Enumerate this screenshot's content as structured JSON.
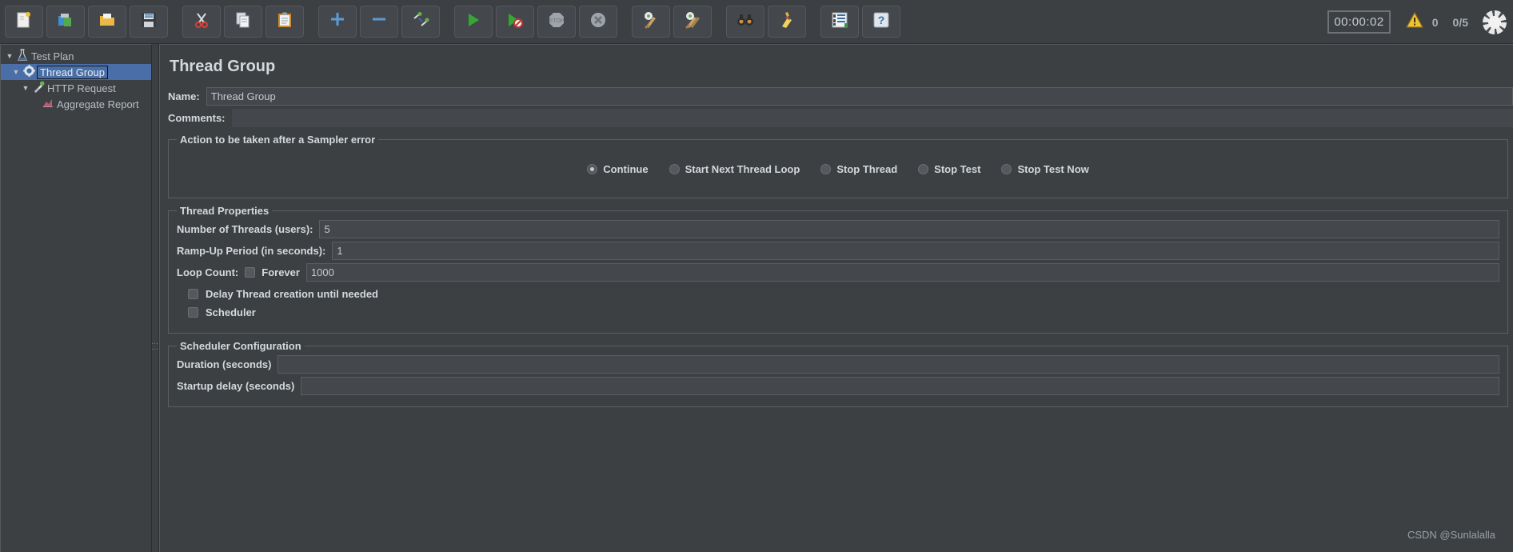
{
  "toolbar": {
    "buttons": [
      {
        "name": "new-test-plan-button",
        "icon": "new-document-icon",
        "glyph": "🗎",
        "label": "New"
      },
      {
        "name": "templates-button",
        "icon": "templates-icon",
        "glyph": "📦",
        "label": "Templates"
      },
      {
        "name": "open-button",
        "icon": "open-folder-icon",
        "glyph": "📂",
        "label": "Open"
      },
      {
        "name": "save-button",
        "icon": "floppy-disk-icon",
        "glyph": "💾",
        "label": "Save Test Plan"
      },
      {
        "name": "cut-button",
        "icon": "scissors-icon",
        "glyph": "✂",
        "label": "Cut"
      },
      {
        "name": "copy-button",
        "icon": "copy-icon",
        "glyph": "🗐",
        "label": "Copy"
      },
      {
        "name": "paste-button",
        "icon": "clipboard-icon",
        "glyph": "📋",
        "label": "Paste"
      },
      {
        "name": "expand-all-button",
        "icon": "plus-icon",
        "glyph": "+",
        "label": "Expand All"
      },
      {
        "name": "collapse-all-button",
        "icon": "minus-icon",
        "glyph": "−",
        "label": "Collapse All"
      },
      {
        "name": "toggle-button",
        "icon": "toggle-icon",
        "glyph": "🖉",
        "label": "Toggle"
      },
      {
        "name": "start-button",
        "icon": "play-icon",
        "glyph": "▶",
        "label": "Start"
      },
      {
        "name": "start-no-pauses-button",
        "icon": "play-no-pause-icon",
        "glyph": "▶",
        "label": "Start no pauses"
      },
      {
        "name": "stop-button",
        "icon": "stop-sign-icon",
        "glyph": "⬣",
        "label": "Stop"
      },
      {
        "name": "shutdown-button",
        "icon": "shutdown-icon",
        "glyph": "✖",
        "label": "Shutdown"
      },
      {
        "name": "clear-button",
        "icon": "gear-broom-icon",
        "glyph": "🧹",
        "label": "Clear"
      },
      {
        "name": "clear-all-button",
        "icon": "gear-broom-all-icon",
        "glyph": "🧹",
        "label": "Clear All"
      },
      {
        "name": "search-button",
        "icon": "binoculars-icon",
        "glyph": "🔭",
        "label": "Search"
      },
      {
        "name": "reset-search-button",
        "icon": "broom-icon",
        "glyph": "🧹",
        "label": "Reset Search"
      },
      {
        "name": "function-helper-button",
        "icon": "list-panel-icon",
        "glyph": "📃",
        "label": "Function Helper Dialog"
      },
      {
        "name": "help-button",
        "icon": "help-icon",
        "glyph": "?",
        "label": "Help"
      }
    ],
    "elapsed_time": "00:00:02",
    "warning_count": "0",
    "thread_count": "0/5"
  },
  "tree": {
    "nodes": [
      {
        "name": "tree-node-test-plan",
        "label": "Test Plan",
        "icon": "flask-icon",
        "glyph": "⚗",
        "indent": 0,
        "twisty": "▼",
        "selected": false
      },
      {
        "name": "tree-node-thread-group",
        "label": "Thread Group",
        "icon": "gear-icon",
        "glyph": "⚙",
        "indent": 1,
        "twisty": "▼",
        "selected": true
      },
      {
        "name": "tree-node-http-request",
        "label": "HTTP Request",
        "icon": "pipette-icon",
        "glyph": "🧪",
        "indent": 2,
        "twisty": "▼",
        "selected": false
      },
      {
        "name": "tree-node-aggregate-report",
        "label": "Aggregate Report",
        "icon": "chart-icon",
        "glyph": "📈",
        "indent": 3,
        "twisty": "",
        "selected": false
      }
    ]
  },
  "main": {
    "title": "Thread Group",
    "name_label": "Name:",
    "name_value": "Thread Group",
    "comments_label": "Comments:",
    "comments_value": "",
    "sampler_error": {
      "legend": "Action to be taken after a Sampler error",
      "options": [
        {
          "name": "radio-continue",
          "label": "Continue",
          "checked": true
        },
        {
          "name": "radio-start-next-thread-loop",
          "label": "Start Next Thread Loop",
          "checked": false
        },
        {
          "name": "radio-stop-thread",
          "label": "Stop Thread",
          "checked": false
        },
        {
          "name": "radio-stop-test",
          "label": "Stop Test",
          "checked": false
        },
        {
          "name": "radio-stop-test-now",
          "label": "Stop Test Now",
          "checked": false
        }
      ]
    },
    "thread_properties": {
      "legend": "Thread Properties",
      "num_threads_label": "Number of Threads (users):",
      "num_threads_value": "5",
      "ramp_up_label": "Ramp-Up Period (in seconds):",
      "ramp_up_value": "1",
      "loop_count_label": "Loop Count:",
      "forever_label": "Forever",
      "forever_checked": false,
      "loop_count_value": "1000",
      "delay_thread_label": "Delay Thread creation until needed",
      "delay_thread_checked": false,
      "scheduler_label": "Scheduler",
      "scheduler_checked": false
    },
    "scheduler_configuration": {
      "legend": "Scheduler Configuration",
      "duration_label": "Duration (seconds)",
      "duration_value": "",
      "startup_delay_label": "Startup delay (seconds)",
      "startup_delay_value": ""
    }
  },
  "watermark": "CSDN @Sunlalalla"
}
